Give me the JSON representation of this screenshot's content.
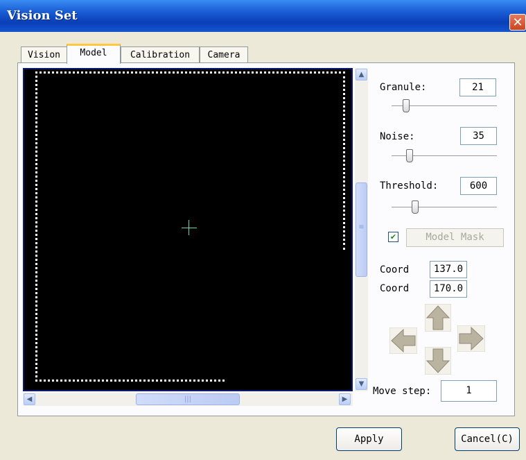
{
  "window": {
    "title": "Vision Set",
    "close_glyph": "✕"
  },
  "tabs": [
    {
      "label": "Vision",
      "active": false
    },
    {
      "label": "Model",
      "active": true
    },
    {
      "label": "Calibration",
      "active": false
    },
    {
      "label": "Camera",
      "active": false
    }
  ],
  "controls": {
    "granule": {
      "label": "Granule:",
      "value": "21"
    },
    "noise": {
      "label": "Noise:",
      "value": "35"
    },
    "threshold": {
      "label": "Threshold:",
      "value": "600"
    },
    "model_mask": {
      "label": "Model Mask",
      "checked": true,
      "check_glyph": "✔"
    },
    "coord_x": {
      "label": "Coord",
      "value": "137.0"
    },
    "coord_y": {
      "label": "Coord",
      "value": "170.0"
    },
    "move_step": {
      "label": "Move step:",
      "value": "1"
    }
  },
  "scrollbar": {
    "up_glyph": "▲",
    "down_glyph": "▼",
    "left_glyph": "◀",
    "right_glyph": "▶",
    "v_grip": "≡",
    "h_grip": "|||"
  },
  "buttons": {
    "apply": "Apply",
    "cancel": "Cancel(C)"
  },
  "icons": {
    "nav": [
      "arrow-up-icon",
      "arrow-down-icon",
      "arrow-left-icon",
      "arrow-right-icon"
    ],
    "viewport": [
      "crosshair-icon"
    ]
  },
  "colors": {
    "title_bar": "#0a3fb8",
    "viewport_bg": "#000000",
    "crosshair": "#6fd6b8",
    "arrow_fill": "#b9b3a0",
    "check": "#1e8a1e"
  }
}
